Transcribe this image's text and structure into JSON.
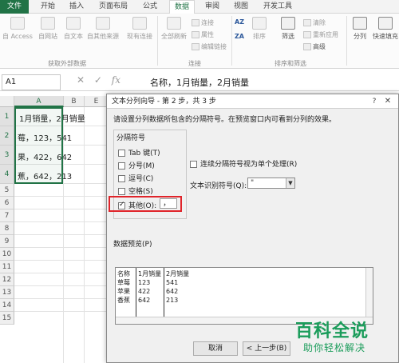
{
  "ribbon_tabs": [
    "文件",
    "开始",
    "插入",
    "页面布局",
    "公式",
    "数据",
    "审阅",
    "视图",
    "开发工具"
  ],
  "active_tab": "数据",
  "ribbon": {
    "get_external": [
      "自 Access",
      "自网站",
      "自文本",
      "自其他来源",
      "现有连接"
    ],
    "refresh_all": "全部刷新",
    "connections": [
      "连接",
      "属性",
      "编辑链接"
    ],
    "sort_filter": [
      "排序",
      "筛选"
    ],
    "filter_small": [
      "清除",
      "重新应用",
      "高级"
    ],
    "split_col": "分列",
    "flash_fill": "快速填充",
    "group_labels": [
      "获取外部数据",
      "连接",
      "排序和筛选"
    ],
    "az": "AZ",
    "za": "ZA"
  },
  "formula_bar": {
    "name_box": "A1",
    "formula": "名称，1月销量，2月销量",
    "cancel": "✕",
    "enter": "✓",
    "fx": "fx"
  },
  "grid": {
    "columns": [
      "A",
      "B",
      "E"
    ],
    "rows": [
      "1",
      "2",
      "3",
      "4",
      "5",
      "6",
      "7",
      "8",
      "9",
      "10",
      "11",
      "12",
      "13",
      "14",
      "15"
    ],
    "cells": [
      "1月销量，2月销量",
      "莓，123，541",
      "果，422，642",
      "蕉，642，213"
    ]
  },
  "dialog": {
    "title": "文本分列向导 - 第 2 步，共 3 步",
    "help": "?",
    "close": "✕",
    "instruction": "请设置分列数据所包含的分隔符号。在预览窗口内可看到分列的效果。",
    "delimiters_label": "分隔符号",
    "delimiters": [
      {
        "label": "Tab 键(T)",
        "checked": false
      },
      {
        "label": "分号(M)",
        "checked": false
      },
      {
        "label": "逗号(C)",
        "checked": false
      },
      {
        "label": "空格(S)",
        "checked": false
      },
      {
        "label": "其他(O):",
        "checked": true
      }
    ],
    "other_value": "，",
    "consecutive_label": "连续分隔符号视为单个处理(R)",
    "qualifier_label": "文本识别符号(Q):",
    "qualifier_value": "\"",
    "preview_label": "数据预览(P)",
    "preview_rows": [
      [
        "名称",
        "1月销量",
        "2月销量"
      ],
      [
        "草莓",
        "123",
        "541"
      ],
      [
        "苹果",
        "422",
        "642"
      ],
      [
        "香蕉",
        "642",
        "213"
      ]
    ],
    "buttons": [
      "取消",
      "< 上一步(B)"
    ]
  },
  "watermark": {
    "title": "百科全说",
    "subtitle": "助你轻松解决"
  }
}
